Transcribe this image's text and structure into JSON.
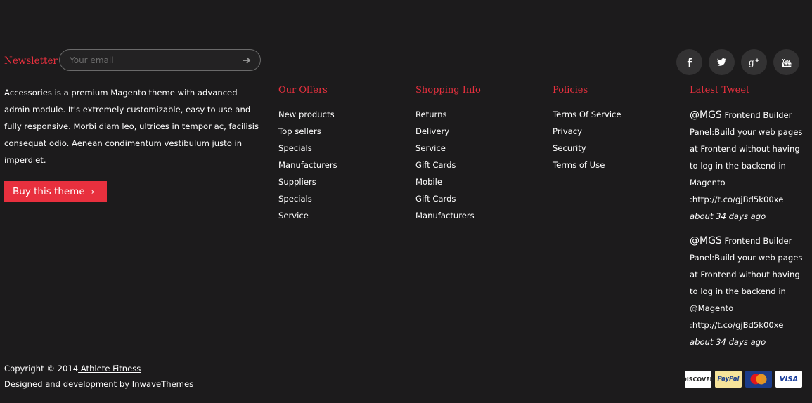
{
  "newsletter": {
    "label": "Newsletter",
    "placeholder": "Your email"
  },
  "social": [
    {
      "icon": "facebook-icon",
      "glyph": "f"
    },
    {
      "icon": "twitter-icon",
      "glyph": "t"
    },
    {
      "icon": "google-plus-icon",
      "glyph": "g+"
    },
    {
      "icon": "youtube-icon",
      "glyph": "yt"
    }
  ],
  "about": {
    "text": "Accessories is a premium Magento theme with advanced admin module. It's extremely customizable, easy to use and fully responsive. Morbi diam leo, ultrices in tempor ac, facilisis consequat odio. Aenean condimentum vestibulum justo in imperdiet.",
    "button": "Buy this theme"
  },
  "columns": [
    {
      "title": "Our Offers",
      "items": [
        "New products",
        "Top sellers",
        "Specials",
        "Manufacturers",
        "Suppliers",
        "Specials",
        "Service"
      ]
    },
    {
      "title": "Shopping Info",
      "items": [
        "Returns",
        "Delivery",
        "Service",
        "Gift Cards",
        "Mobile",
        "Gift Cards",
        "Manufacturers"
      ]
    },
    {
      "title": "Policies",
      "items": [
        "Terms Of Service",
        "Privacy",
        "Security",
        "Terms of Use"
      ]
    }
  ],
  "latest_tweet": {
    "title": "Latest Tweet",
    "tweets": [
      {
        "handle": "@MGS",
        "text": " Frontend Builder Panel:Build your web pages at Frontend without having to log in the backend in Magento :http://t.co/gjBd5k00xe",
        "time": "about 34 days ago"
      },
      {
        "handle": "@MGS",
        "text": " Frontend Builder Panel:Build your web pages at Frontend without having to log in the backend in @Magento :http://t.co/gjBd5k00xe",
        "time": "about 34 days ago"
      }
    ]
  },
  "footer": {
    "copyright_prefix": "Copyright © 2014",
    "copyright_link": " Athlete Fitness",
    "designed": "Designed and development by InwaveThemes"
  },
  "payments": [
    {
      "name": "DISCOVER",
      "icon": "discover-icon"
    },
    {
      "name": "PayPal",
      "icon": "paypal-icon"
    },
    {
      "name": "MasterCard",
      "icon": "mastercard-icon"
    },
    {
      "name": "VISA",
      "icon": "visa-icon"
    }
  ]
}
